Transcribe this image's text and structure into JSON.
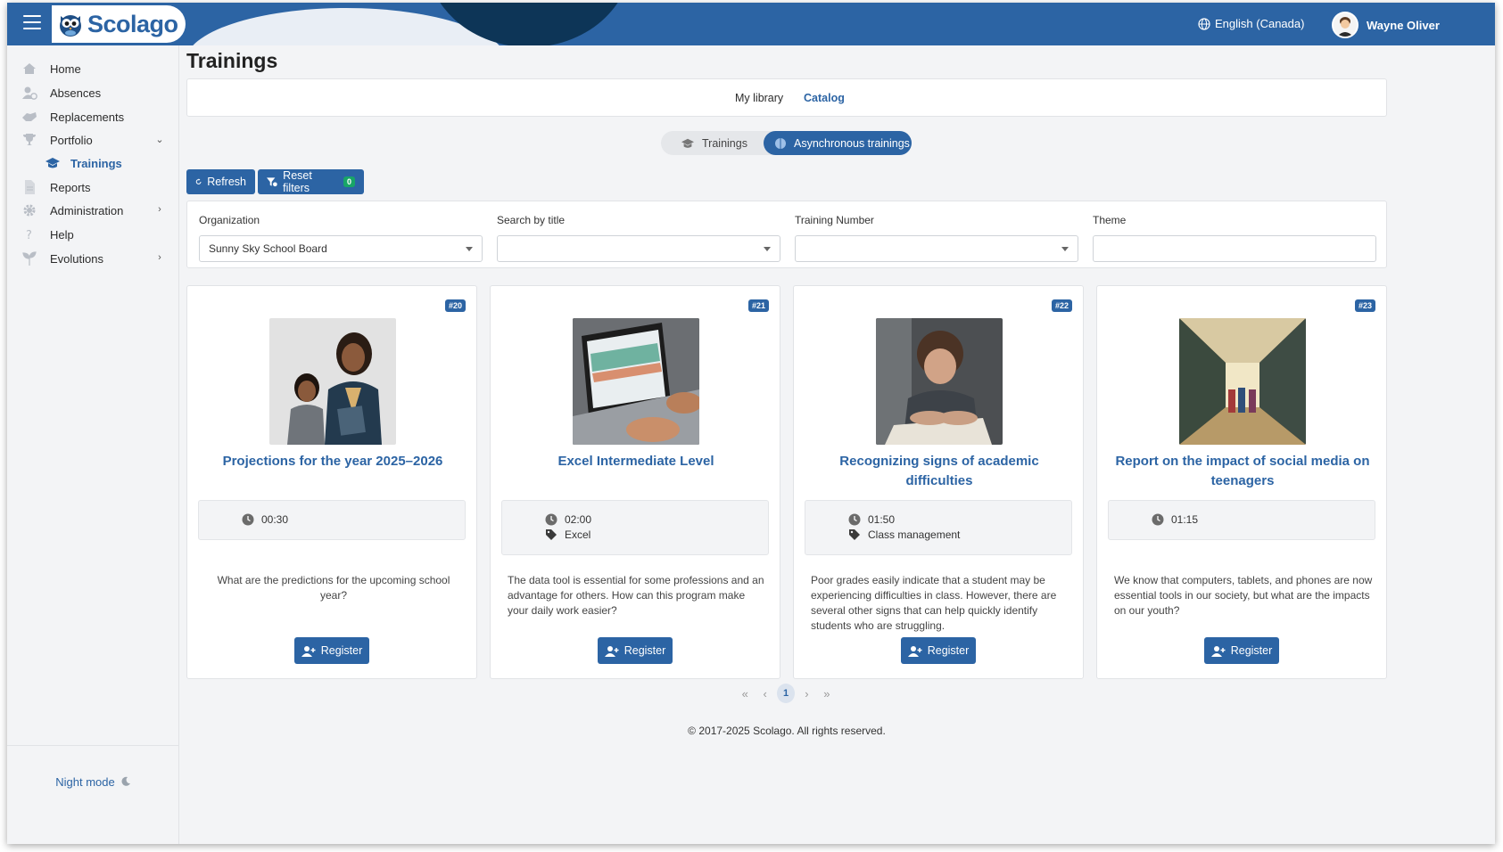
{
  "header": {
    "brand": "Scolago",
    "language": "English (Canada)",
    "user_name": "Wayne Oliver"
  },
  "sidebar": {
    "items": [
      {
        "label": "Home",
        "icon": "home-icon"
      },
      {
        "label": "Absences",
        "icon": "user-clock-icon"
      },
      {
        "label": "Replacements",
        "icon": "handshake-icon"
      },
      {
        "label": "Portfolio",
        "icon": "trophy-icon"
      },
      {
        "label": "Trainings",
        "icon": "graduation-cap-icon"
      },
      {
        "label": "Reports",
        "icon": "document-icon"
      },
      {
        "label": "Administration",
        "icon": "gear-icon"
      },
      {
        "label": "Help",
        "icon": "question-icon"
      },
      {
        "label": "Evolutions",
        "icon": "sprout-icon"
      }
    ],
    "night_mode": "Night mode"
  },
  "page": {
    "title": "Trainings",
    "tabs": [
      "My library",
      "Catalog"
    ],
    "active_tab": "Catalog",
    "toggle": [
      "Trainings",
      "Asynchronous trainings"
    ],
    "active_toggle": "Asynchronous trainings",
    "refresh_label": "Refresh",
    "reset_label": "Reset filters",
    "reset_count": "0"
  },
  "filters": [
    {
      "label": "Organization",
      "value": "Sunny Sky School Board",
      "type": "select"
    },
    {
      "label": "Search by title",
      "value": "",
      "type": "select"
    },
    {
      "label": "Training Number",
      "value": "",
      "type": "select"
    },
    {
      "label": "Theme",
      "value": "",
      "type": "text"
    }
  ],
  "cards": [
    {
      "number": "#20",
      "title": "Projections for the year 2025–2026",
      "duration": "00:30",
      "theme": "",
      "description": "What are the predictions for the upcoming school year?",
      "register": "Register"
    },
    {
      "number": "#21",
      "title": "Excel Intermediate Level",
      "duration": "02:00",
      "theme": "Excel",
      "description": "The data tool is essential for some professions and an advantage for others. How can this program make your daily work easier?",
      "register": "Register"
    },
    {
      "number": "#22",
      "title": "Recognizing signs of academic difficulties",
      "duration": "01:50",
      "theme": "Class management",
      "description": "Poor grades easily indicate that a student may be experiencing difficulties in class. However, there are several other signs that can help quickly identify students who are struggling.",
      "register": "Register"
    },
    {
      "number": "#23",
      "title": "Report on the impact of social media on teenagers",
      "duration": "01:15",
      "theme": "",
      "description": "We know that computers, tablets, and phones are now essential tools in our society, but what are the impacts on our youth?",
      "register": "Register"
    }
  ],
  "pagination": {
    "current": "1"
  },
  "footer": "© 2017-2025 Scolago. All rights reserved.",
  "colors": {
    "primary": "#2c64a4",
    "dark_navy": "#0d3557",
    "badge_green": "#18a567",
    "background": "#f3f4f6"
  }
}
